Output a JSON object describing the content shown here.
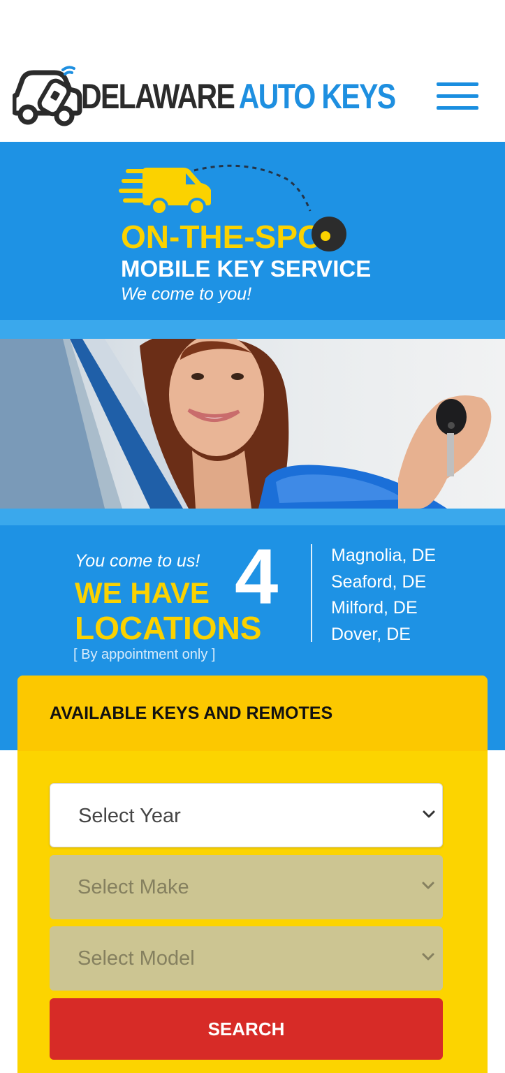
{
  "header": {
    "brand_part1": "DELAWARE",
    "brand_part2": "AUTO KEYS",
    "logo_icon": "car-key-icon",
    "menu_icon": "hamburger-menu-icon"
  },
  "hero": {
    "headline": "ON-THE-SPOT",
    "subheadline": "MOBILE KEY SERVICE",
    "tagline": "We come to you!",
    "illustration": "delivery-van-icon"
  },
  "photo": {
    "subject": "woman-in-car-holding-key"
  },
  "locations": {
    "intro": "You come to us!",
    "we_have": "WE HAVE",
    "count": "4",
    "label": "LOCATIONS",
    "note": "[ By appointment only ]",
    "cities": [
      "Magnolia, DE",
      "Seaford, DE",
      "Milford, DE",
      "Dover, DE"
    ]
  },
  "keys_panel": {
    "title": "AVAILABLE KEYS AND REMOTES",
    "year_placeholder": "Select Year",
    "make_placeholder": "Select Make",
    "model_placeholder": "Select Model",
    "search_label": "SEARCH",
    "chevron_icon": "chevron-down-icon"
  },
  "colors": {
    "brand_blue": "#1e92e4",
    "brand_yellow": "#fcd400",
    "button_red": "#d72b27"
  }
}
